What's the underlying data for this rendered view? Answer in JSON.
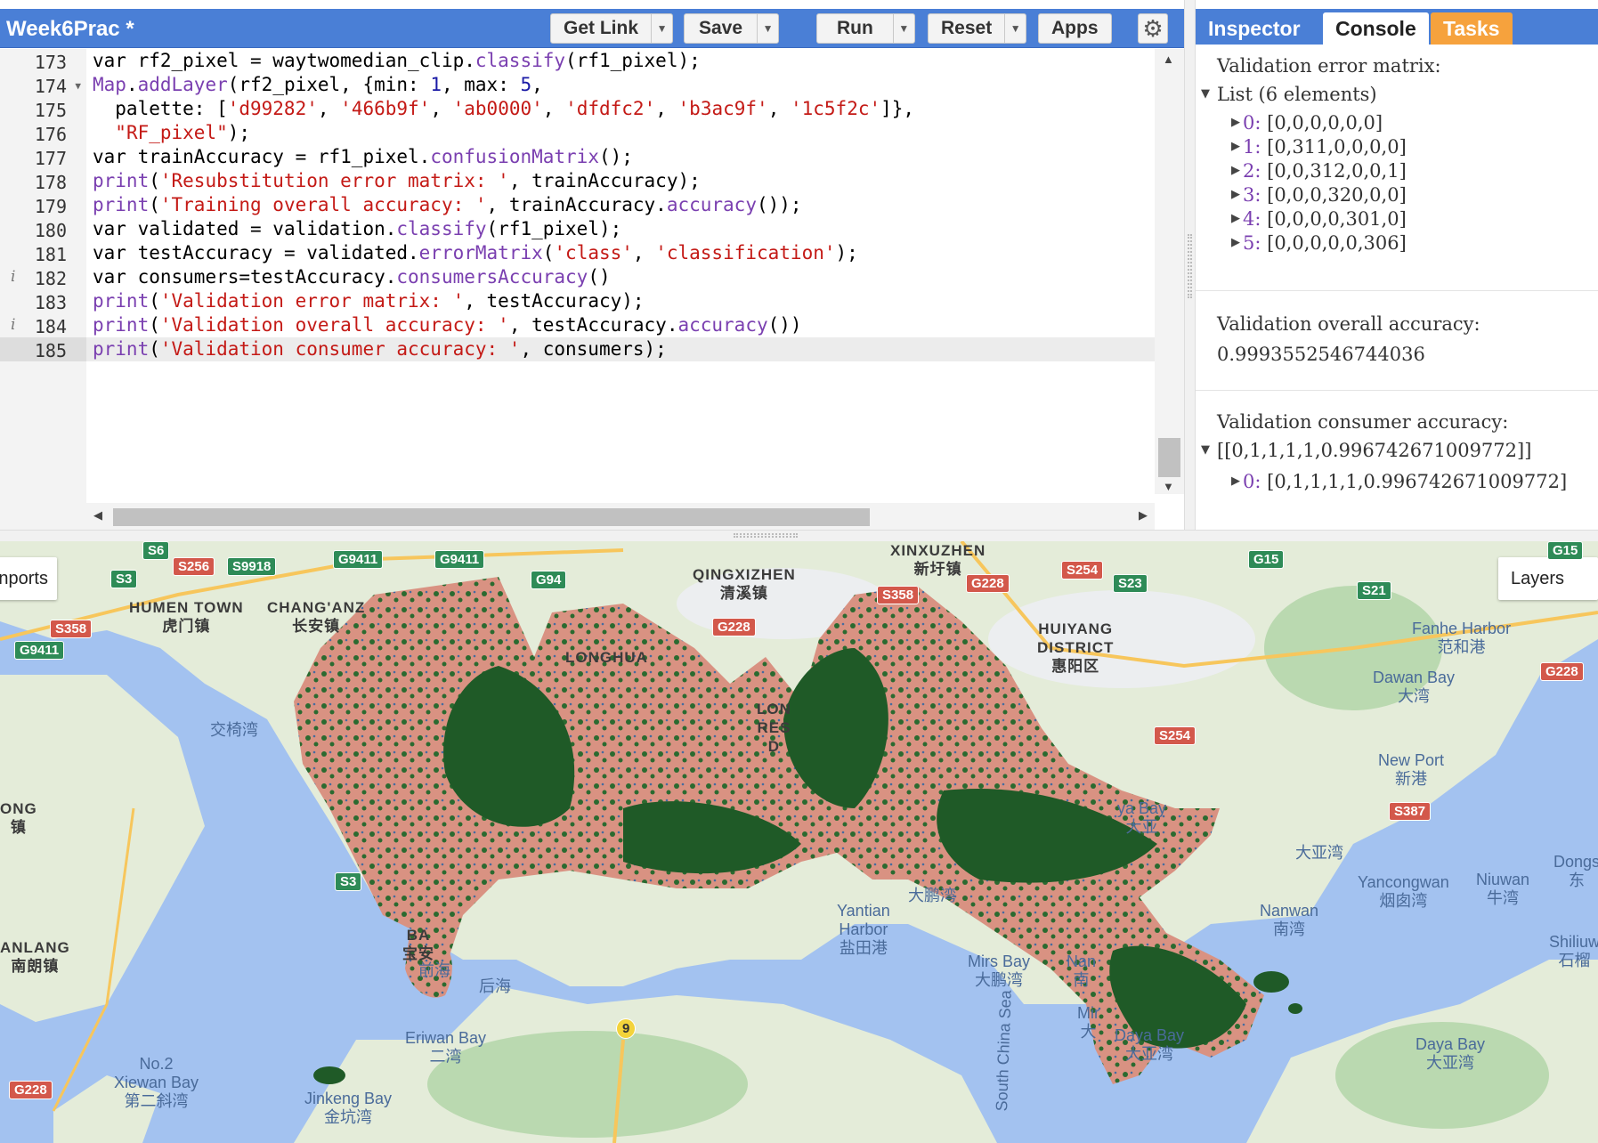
{
  "header": {
    "script_title": "Week6Prac *",
    "buttons": {
      "get_link": "Get Link",
      "save": "Save",
      "run": "Run",
      "reset": "Reset",
      "apps": "Apps"
    }
  },
  "editor": {
    "lines": [
      {
        "num": "173",
        "code": "var rf2_pixel = waytwomedian_clip.classify(rf1_pixel);"
      },
      {
        "num": "174",
        "code": "Map.addLayer(rf2_pixel, {min: 1, max: 5,"
      },
      {
        "num": "175",
        "code": "  palette: ['d99282', '466b9f', 'ab0000', 'dfdfc2', 'b3ac9f', '1c5f2c']},"
      },
      {
        "num": "176",
        "code": "  \"RF_pixel\");"
      },
      {
        "num": "177",
        "code": "var trainAccuracy = rf1_pixel.confusionMatrix();"
      },
      {
        "num": "178",
        "code": "print('Resubstitution error matrix: ', trainAccuracy);"
      },
      {
        "num": "179",
        "code": "print('Training overall accuracy: ', trainAccuracy.accuracy());"
      },
      {
        "num": "180",
        "code": "var validated = validation.classify(rf1_pixel);"
      },
      {
        "num": "181",
        "code": "var testAccuracy = validated.errorMatrix('class', 'classification');"
      },
      {
        "num": "182",
        "code": "var consumers=testAccuracy.consumersAccuracy()"
      },
      {
        "num": "183",
        "code": "print('Validation error matrix: ', testAccuracy);"
      },
      {
        "num": "184",
        "code": "print('Validation overall accuracy: ', testAccuracy.accuracy())"
      },
      {
        "num": "185",
        "code": "print('Validation consumer accuracy: ', consumers);"
      }
    ]
  },
  "right_panel": {
    "tabs": {
      "inspector": "Inspector",
      "console": "Console",
      "tasks": "Tasks"
    },
    "console": {
      "error_matrix_title": "Validation error matrix:",
      "list_label": "List (6 elements)",
      "rows": [
        {
          "idx": "0:",
          "val": "[0,0,0,0,0,0]"
        },
        {
          "idx": "1:",
          "val": "[0,311,0,0,0,0]"
        },
        {
          "idx": "2:",
          "val": "[0,0,312,0,0,1]"
        },
        {
          "idx": "3:",
          "val": "[0,0,0,320,0,0]"
        },
        {
          "idx": "4:",
          "val": "[0,0,0,0,301,0]"
        },
        {
          "idx": "5:",
          "val": "[0,0,0,0,0,306]"
        }
      ],
      "overall_title": "Validation overall accuracy:",
      "overall_value": "0.9993552546744036",
      "consumer_title": "Validation consumer accuracy:",
      "consumer_value": "[[0,1,1,1,1,0.996742671009772]]",
      "consumer_row_idx": "0:",
      "consumer_row_val": "[0,1,1,1,1,0.996742671009772]"
    }
  },
  "map": {
    "imports_label": "nports",
    "layers_label": "Layers",
    "colors": {
      "water": "#a3c2f0",
      "land": "#e4ecd9",
      "urban": "#eceef0",
      "forest": "#bad9b0",
      "class_pink": "#d99282",
      "class_green": "#1f5a27",
      "class_blue": "#466b9f",
      "road": "#f7c65c"
    },
    "labels": [
      {
        "text": "XINXUZHEN\n新圩镇",
        "kind": "land"
      },
      {
        "text": "QINGXIZHEN\n清溪镇",
        "kind": "land"
      },
      {
        "text": "HUMEN TOWN\n虎门镇",
        "kind": "land"
      },
      {
        "text": "CHANG'ANZ\n长安镇",
        "kind": "land"
      },
      {
        "text": "HUIYANG\nDISTRICT\n惠阳区",
        "kind": "land"
      },
      {
        "text": "LONGHUA",
        "kind": "land"
      },
      {
        "text": "LON\nRES\nD",
        "kind": "land"
      },
      {
        "text": "ONG\n镇",
        "kind": "land"
      },
      {
        "text": "ANLANG\n南朗镇",
        "kind": "land"
      },
      {
        "text": "BA\n宝安",
        "kind": "land"
      },
      {
        "text": "交椅湾",
        "kind": "water"
      },
      {
        "text": "Fanhe Harbor\n范和港",
        "kind": "water"
      },
      {
        "text": "Dawan Bay\n大湾",
        "kind": "water"
      },
      {
        "text": "New Port\n新港",
        "kind": "water"
      },
      {
        "text": "ya Bay\n大亚",
        "kind": "water"
      },
      {
        "text": "大亚湾",
        "kind": "water"
      },
      {
        "text": "Yancongwan\n烟囱湾",
        "kind": "water"
      },
      {
        "text": "Niuwan\n牛湾",
        "kind": "water"
      },
      {
        "text": "Dongs\n东",
        "kind": "water"
      },
      {
        "text": "Nanwan\n南湾",
        "kind": "water"
      },
      {
        "text": "Shiliuw\n石榴",
        "kind": "water"
      },
      {
        "text": "大鹏湾",
        "kind": "water"
      },
      {
        "text": "Yantian\nHarbor\n盐田港",
        "kind": "water"
      },
      {
        "text": "Mirs Bay\n大鹏湾",
        "kind": "water"
      },
      {
        "text": "Nan\n南",
        "kind": "water"
      },
      {
        "text": "Mir\n大",
        "kind": "water"
      },
      {
        "text": "Daya Bay\n大亚湾",
        "kind": "water"
      },
      {
        "text": "Daya Bay\n大亚湾",
        "kind": "water"
      },
      {
        "text": "前海",
        "kind": "water"
      },
      {
        "text": "后海",
        "kind": "water"
      },
      {
        "text": "Eriwan Bay\n二湾",
        "kind": "water"
      },
      {
        "text": "No.2\nXiewan Bay\n第二斜湾",
        "kind": "water"
      },
      {
        "text": "Jinkeng Bay\n金坑湾",
        "kind": "water"
      },
      {
        "text": "South China Sea",
        "kind": "water"
      }
    ],
    "shields": [
      {
        "text": "S6",
        "kind": "green"
      },
      {
        "text": "S256",
        "kind": "red"
      },
      {
        "text": "S9918",
        "kind": "green"
      },
      {
        "text": "S3",
        "kind": "green"
      },
      {
        "text": "G9411",
        "kind": "green"
      },
      {
        "text": "G9411",
        "kind": "green"
      },
      {
        "text": "G94",
        "kind": "green"
      },
      {
        "text": "S358",
        "kind": "red"
      },
      {
        "text": "G9411",
        "kind": "green"
      },
      {
        "text": "G228",
        "kind": "red"
      },
      {
        "text": "S358",
        "kind": "red"
      },
      {
        "text": "G228",
        "kind": "red"
      },
      {
        "text": "S254",
        "kind": "red"
      },
      {
        "text": "S23",
        "kind": "green"
      },
      {
        "text": "G15",
        "kind": "green"
      },
      {
        "text": "S21",
        "kind": "green"
      },
      {
        "text": "G15",
        "kind": "green"
      },
      {
        "text": "G228",
        "kind": "red"
      },
      {
        "text": "S254",
        "kind": "red"
      },
      {
        "text": "S387",
        "kind": "red"
      },
      {
        "text": "S3",
        "kind": "green"
      },
      {
        "text": "9",
        "kind": "yellow"
      },
      {
        "text": "G228",
        "kind": "red"
      }
    ]
  }
}
